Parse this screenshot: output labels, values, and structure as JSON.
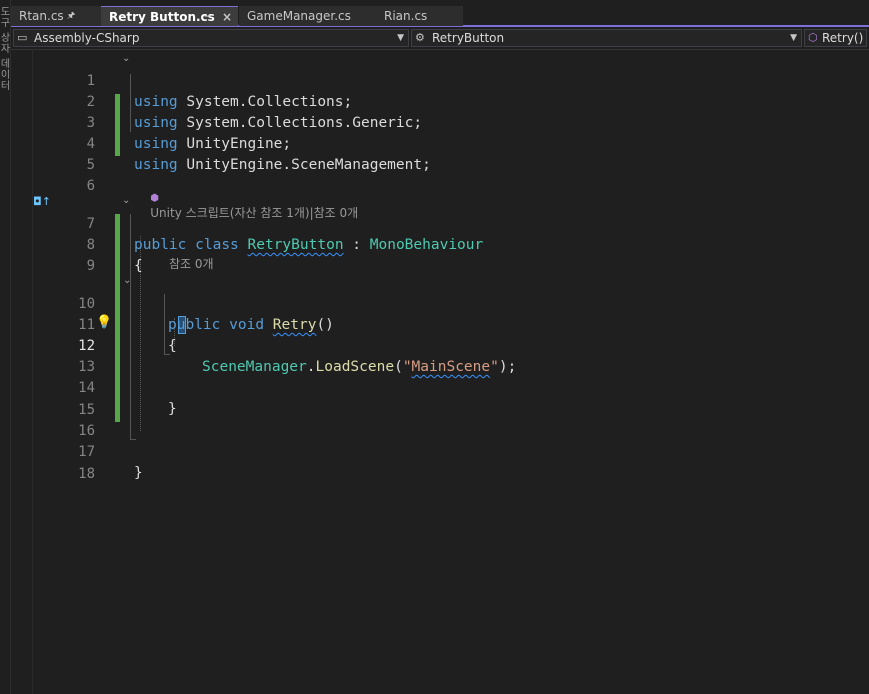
{
  "sidebar": {
    "text": "도구 상자 데이터"
  },
  "tabs": [
    {
      "label": "Rtan.cs",
      "pin": "🖈",
      "active": false
    },
    {
      "label": "Retry Button.cs",
      "pin": "⊸",
      "close": "×",
      "active": true
    },
    {
      "label": "GameManager.cs",
      "active": false
    },
    {
      "label": "Rian.cs",
      "active": false
    }
  ],
  "nav": {
    "project": "Assembly-CSharp",
    "type": "RetryButton",
    "member": "Retry()"
  },
  "codelens": {
    "class_ref": "Unity 스크립트(자산 참조 1개)|참조 0개",
    "method_ref": "참조 0개"
  },
  "line_numbers": [
    "1",
    "2",
    "3",
    "4",
    "5",
    "6",
    "7",
    "8",
    "9",
    "10",
    "11",
    "12",
    "13",
    "14",
    "15",
    "16",
    "17",
    "18"
  ],
  "code": {
    "l1_kw": "using",
    "l1_ns": " System.Collections;",
    "l2_kw": "using",
    "l2_ns": " System.Collections.Generic;",
    "l3_kw": "using",
    "l3_ns": " UnityEngine;",
    "l4_kw": "using",
    "l4_ns": " UnityEngine.SceneManagement;",
    "l7_kw1": "public",
    "l7_kw2": "class",
    "l7_name": "RetryButton",
    "l7_colon": " : ",
    "l7_base": "MonoBehaviour",
    "l8": "{",
    "l10_kw1": "public",
    "l10_kw2": "void",
    "l10_name": "Retry",
    "l10_parens": "()",
    "l11": "{",
    "l12_type": "SceneManager",
    "l12_dot": ".",
    "l12_method": "LoadScene",
    "l12_open": "(",
    "l12_str_q1": "\"",
    "l12_str": "MainScene",
    "l12_str_q2": "\"",
    "l12_close": ");",
    "l14": "}",
    "l17": "}"
  },
  "colors": {
    "keyword": "#569cd6",
    "type": "#4ec9b0",
    "method": "#dcdcaa",
    "string": "#d69d85",
    "tab_accent": "#7e6fd6",
    "change_bar": "#57a64a"
  }
}
